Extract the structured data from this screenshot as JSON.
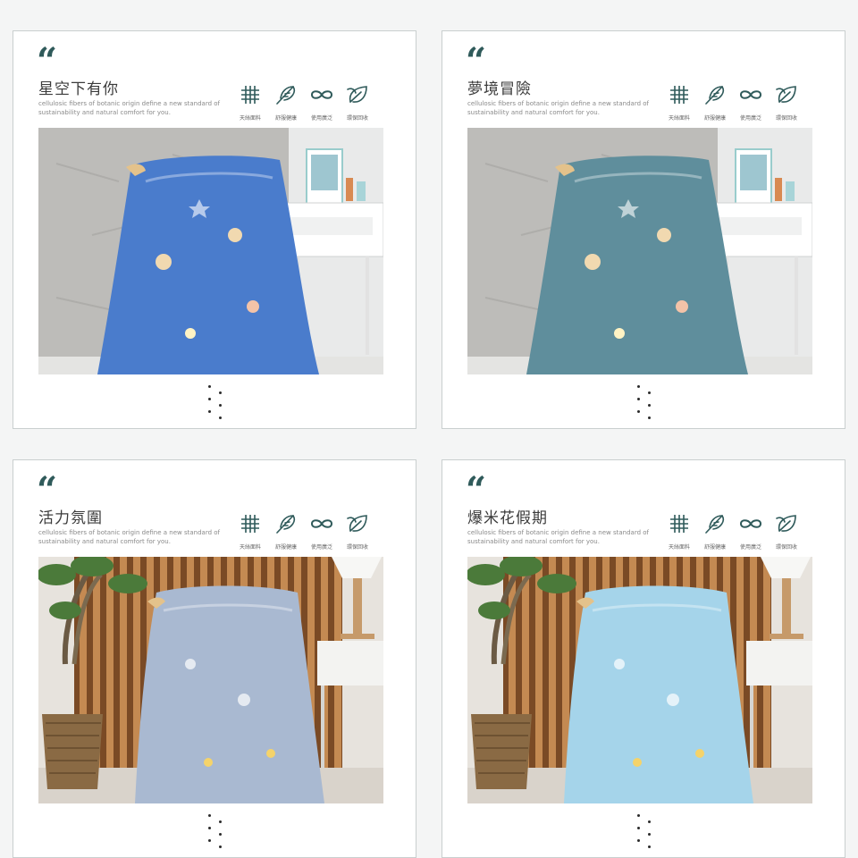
{
  "colors": {
    "accent": "#2f5a5a",
    "card_border": "#c9cfcf"
  },
  "cards": [
    {
      "title": "星空下有你",
      "desc": "cellulosic fibers of botanic origin define a new standard of sustainability and natural comfort for you.",
      "features": [
        {
          "icon": "grid-fabric-icon",
          "label": "天絲面料"
        },
        {
          "icon": "feather-icon",
          "label": "舒服健康"
        },
        {
          "icon": "infinity-icon",
          "label": "使用廣泛"
        },
        {
          "icon": "leaf-icon",
          "label": "環保回收"
        }
      ],
      "blanket_color": "#4a7ccc",
      "scene": "gray-wall-bedroom"
    },
    {
      "title": "夢境冒險",
      "desc": "cellulosic fibers of botanic origin define a new standard of sustainability and natural comfort for you.",
      "features": [
        {
          "icon": "grid-fabric-icon",
          "label": "天絲面料"
        },
        {
          "icon": "feather-icon",
          "label": "舒服健康"
        },
        {
          "icon": "infinity-icon",
          "label": "使用廣泛"
        },
        {
          "icon": "leaf-icon",
          "label": "環保回收"
        }
      ],
      "blanket_color": "#5f8e9c",
      "scene": "gray-wall-bedroom"
    },
    {
      "title": "活力氛圍",
      "desc": "cellulosic fibers of botanic origin define a new standard of sustainability and natural comfort for you.",
      "features": [
        {
          "icon": "grid-fabric-icon",
          "label": "天絲面料"
        },
        {
          "icon": "feather-icon",
          "label": "舒服健康"
        },
        {
          "icon": "infinity-icon",
          "label": "使用廣泛"
        },
        {
          "icon": "leaf-icon",
          "label": "環保回收"
        }
      ],
      "blanket_color": "#a9b9d1",
      "scene": "wood-slat-living-room"
    },
    {
      "title": "爆米花假期",
      "desc": "cellulosic fibers of botanic origin define a new standard of sustainability and natural comfort for you.",
      "features": [
        {
          "icon": "grid-fabric-icon",
          "label": "天絲面料"
        },
        {
          "icon": "feather-icon",
          "label": "舒服健康"
        },
        {
          "icon": "infinity-icon",
          "label": "使用廣泛"
        },
        {
          "icon": "leaf-icon",
          "label": "環保回收"
        }
      ],
      "blanket_color": "#a5d4ea",
      "scene": "wood-slat-living-room"
    }
  ]
}
